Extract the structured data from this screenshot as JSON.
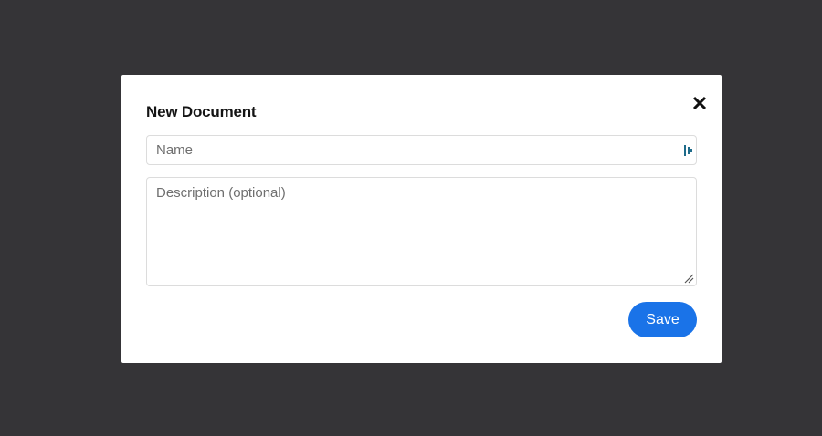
{
  "modal": {
    "title": "New Document",
    "close_icon": "close-icon",
    "name_field": {
      "placeholder": "Name",
      "value": "",
      "trailing_icon": "autofill-icon"
    },
    "description_field": {
      "placeholder": "Description (optional)",
      "value": ""
    },
    "save_label": "Save"
  },
  "colors": {
    "backdrop": "#353437",
    "modal_bg": "#ffffff",
    "primary_button": "#1a73e8",
    "field_border": "#dcdcdc",
    "autofill_icon": "#1e6b8a"
  }
}
